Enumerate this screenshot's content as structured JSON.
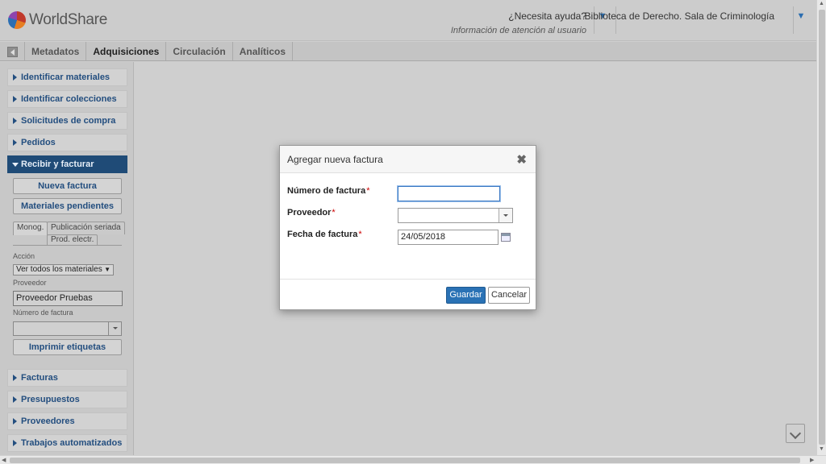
{
  "header": {
    "logo_text": "WorldShare",
    "help_title": "¿Necesita ayuda?",
    "help_subtitle": "Información de atención al usuario",
    "library": "Biblioteca de Derecho. Sala de Criminología"
  },
  "tabs": [
    {
      "label": "Metadatos"
    },
    {
      "label": "Adquisiciones"
    },
    {
      "label": "Circulación"
    },
    {
      "label": "Analíticos"
    }
  ],
  "sidebar": {
    "items_top": [
      {
        "label": "Identificar materiales"
      },
      {
        "label": "Identificar colecciones"
      },
      {
        "label": "Solicitudes de compra"
      },
      {
        "label": "Pedidos"
      },
      {
        "label": "Recibir y facturar"
      }
    ],
    "new_invoice_btn": "Nueva factura",
    "pending_btn": "Materiales pendientes",
    "subtabs": [
      "Monog.",
      "Publicación seriada",
      "Prod. electr."
    ],
    "action_label": "Acción",
    "action_value": "Ver todos los materiales",
    "provider_label": "Proveedor",
    "provider_value": "Proveedor Pruebas",
    "invoice_no_label": "Número de factura",
    "print_btn": "Imprimir etiquetas",
    "items_bottom": [
      {
        "label": "Facturas"
      },
      {
        "label": "Presupuestos"
      },
      {
        "label": "Proveedores"
      },
      {
        "label": "Trabajos automatizados"
      }
    ]
  },
  "modal": {
    "title": "Agregar nueva factura",
    "close": "✖",
    "fields": {
      "invoice_number_label": "Número de factura",
      "invoice_number_value": "",
      "provider_label": "Proveedor",
      "provider_value": "",
      "date_label": "Fecha de factura",
      "date_value": "24/05/2018"
    },
    "required_mark": "*",
    "save": "Guardar",
    "cancel": "Cancelar"
  }
}
